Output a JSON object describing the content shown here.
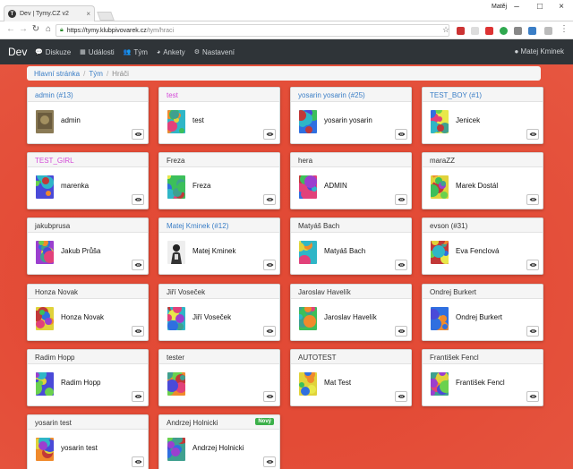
{
  "browser": {
    "tab_title": "Dev | Tymy.CZ v2",
    "tab_close": "×",
    "favicon": "T",
    "window_user": "Matěj",
    "url_host": "https://tymy.klubpivovarek.cz",
    "url_path": "/tym/hraci"
  },
  "nav": {
    "brand": "Dev",
    "items": [
      {
        "label": "Diskuze",
        "icon": "comments-icon",
        "glyph": "💬"
      },
      {
        "label": "Události",
        "icon": "calendar-icon",
        "glyph": "▦"
      },
      {
        "label": "Tým",
        "icon": "users-icon",
        "glyph": "👥"
      },
      {
        "label": "Ankety",
        "icon": "poll-icon",
        "glyph": "◕"
      },
      {
        "label": "Nastavení",
        "icon": "cogs-icon",
        "glyph": "⚙"
      }
    ],
    "user": "Matej Kminek",
    "user_icon": "user-circle-icon"
  },
  "breadcrumb": {
    "home": "Hlavní stránka",
    "team": "Tým",
    "current": "Hráči",
    "sep": "/"
  },
  "players": [
    {
      "header": "admin (#13)",
      "name": "admin",
      "style": "blue",
      "avatar": "photo-brown"
    },
    {
      "header": "test",
      "name": "test",
      "style": "pink",
      "avatar": "mosaic"
    },
    {
      "header": "yosarin yosarin (#25)",
      "name": "yosarin yosarin",
      "style": "blue",
      "avatar": "mosaic"
    },
    {
      "header": "TEST_BOY (#1)",
      "name": "Jenicek",
      "style": "blue",
      "avatar": "mosaic"
    },
    {
      "header": "TEST_GIRL",
      "name": "marenka",
      "style": "pink",
      "avatar": "mosaic"
    },
    {
      "header": "Freza",
      "name": "Freza",
      "style": "plain",
      "avatar": "mosaic"
    },
    {
      "header": "hera",
      "name": "ADMIN",
      "style": "plain",
      "avatar": "mosaic"
    },
    {
      "header": "maraZZ",
      "name": "Marek Dostál",
      "style": "plain",
      "avatar": "mosaic"
    },
    {
      "header": "jakubprusa",
      "name": "Jakub Průša",
      "style": "plain",
      "avatar": "mosaic"
    },
    {
      "header": "Matej Kminek (#12)",
      "name": "Matej Kminek",
      "style": "blue",
      "avatar": "photo-dark"
    },
    {
      "header": "Matyáš Bach",
      "name": "Matyáš Bach",
      "style": "plain",
      "avatar": "mosaic"
    },
    {
      "header": "evson (#31)",
      "name": "Eva Fenclová",
      "style": "plain",
      "avatar": "mosaic"
    },
    {
      "header": "Honza Novak",
      "name": "Honza Novak",
      "style": "plain",
      "avatar": "mosaic"
    },
    {
      "header": "Jiří Voseček",
      "name": "Jiří Voseček",
      "style": "plain",
      "avatar": "mosaic"
    },
    {
      "header": "Jaroslav Havelík",
      "name": "Jaroslav Havelík",
      "style": "plain",
      "avatar": "mosaic"
    },
    {
      "header": "Ondrej Burkert",
      "name": "Ondrej Burkert",
      "style": "plain",
      "avatar": "mosaic"
    },
    {
      "header": "Radim Hopp",
      "name": "Radim Hopp",
      "style": "plain",
      "avatar": "mosaic"
    },
    {
      "header": "tester",
      "name": "",
      "style": "plain",
      "avatar": "mosaic"
    },
    {
      "header": "AUTOTEST",
      "name": "Mat Test",
      "style": "plain",
      "avatar": "mosaic"
    },
    {
      "header": "František Fencl",
      "name": "František Fencl",
      "style": "plain",
      "avatar": "mosaic"
    },
    {
      "header": "yosarin test",
      "name": "yosarin test",
      "style": "plain",
      "avatar": "mosaic"
    },
    {
      "header": "Andrzej Holnicki",
      "name": "Andrzej Holnicki",
      "style": "plain",
      "avatar": "mosaic",
      "badge": "Nový"
    }
  ],
  "view_button_icon": "eye-icon",
  "colors": {
    "navbar": "#2f3438",
    "background_red": "#e34b36",
    "link_blue": "#3a7ec6",
    "pink": "#d44ad8",
    "badge_green": "#3cb04a"
  }
}
